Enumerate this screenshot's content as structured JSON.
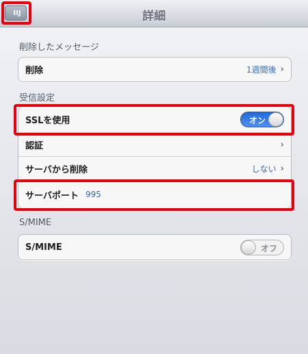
{
  "nav": {
    "title": "詳細",
    "back_label": "IIJ"
  },
  "sections": {
    "deleted": {
      "header": "削除したメッセージ",
      "rows": [
        {
          "label": "削除",
          "value": "1週間後"
        }
      ]
    },
    "incoming": {
      "header": "受信設定",
      "ssl": {
        "label": "SSLを使用",
        "toggle": "オン"
      },
      "auth": {
        "label": "認証"
      },
      "delete_from_server": {
        "label": "サーバから削除",
        "value": "しない"
      },
      "port": {
        "label": "サーバポート",
        "value": "995"
      }
    },
    "smime": {
      "header": "S/MIME",
      "row": {
        "label": "S/MIME",
        "toggle": "オフ"
      }
    }
  },
  "colors": {
    "highlight": "#e8000c",
    "toggle_on": "#1f6ad9",
    "value_text": "#3c6aa8"
  }
}
